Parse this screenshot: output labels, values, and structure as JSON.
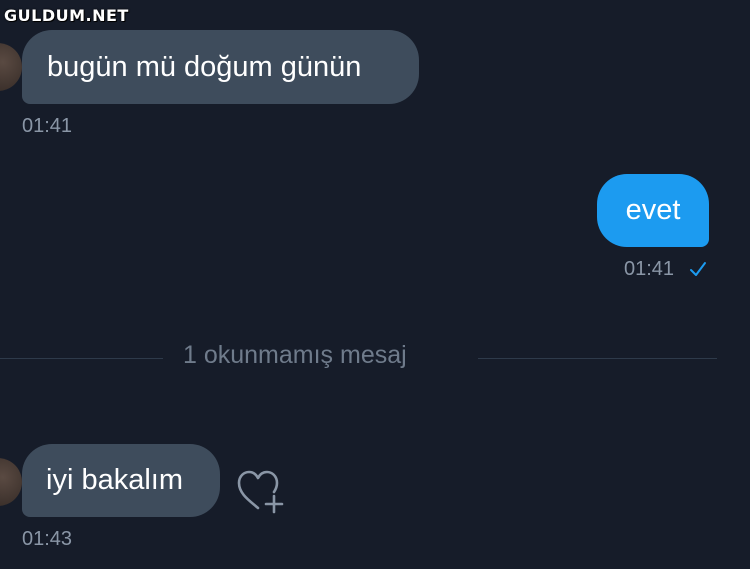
{
  "watermark": "GULDUM.NET",
  "messages": [
    {
      "text": "bugün mü doğum günün",
      "time": "01:41",
      "direction": "incoming"
    },
    {
      "text": "evet",
      "time": "01:41",
      "direction": "outgoing",
      "status_icon": "check-icon"
    },
    {
      "text": "iyi bakalım",
      "time": "01:43",
      "direction": "incoming",
      "action_icon": "heart-plus-icon"
    }
  ],
  "unread_divider": "1 okunmamış mesaj",
  "colors": {
    "background": "#161c29",
    "incoming_bubble": "#3e4c5c",
    "outgoing_bubble": "#1c9bf0",
    "timestamp": "#8a96a6",
    "divider_text": "#6f7b8b"
  }
}
